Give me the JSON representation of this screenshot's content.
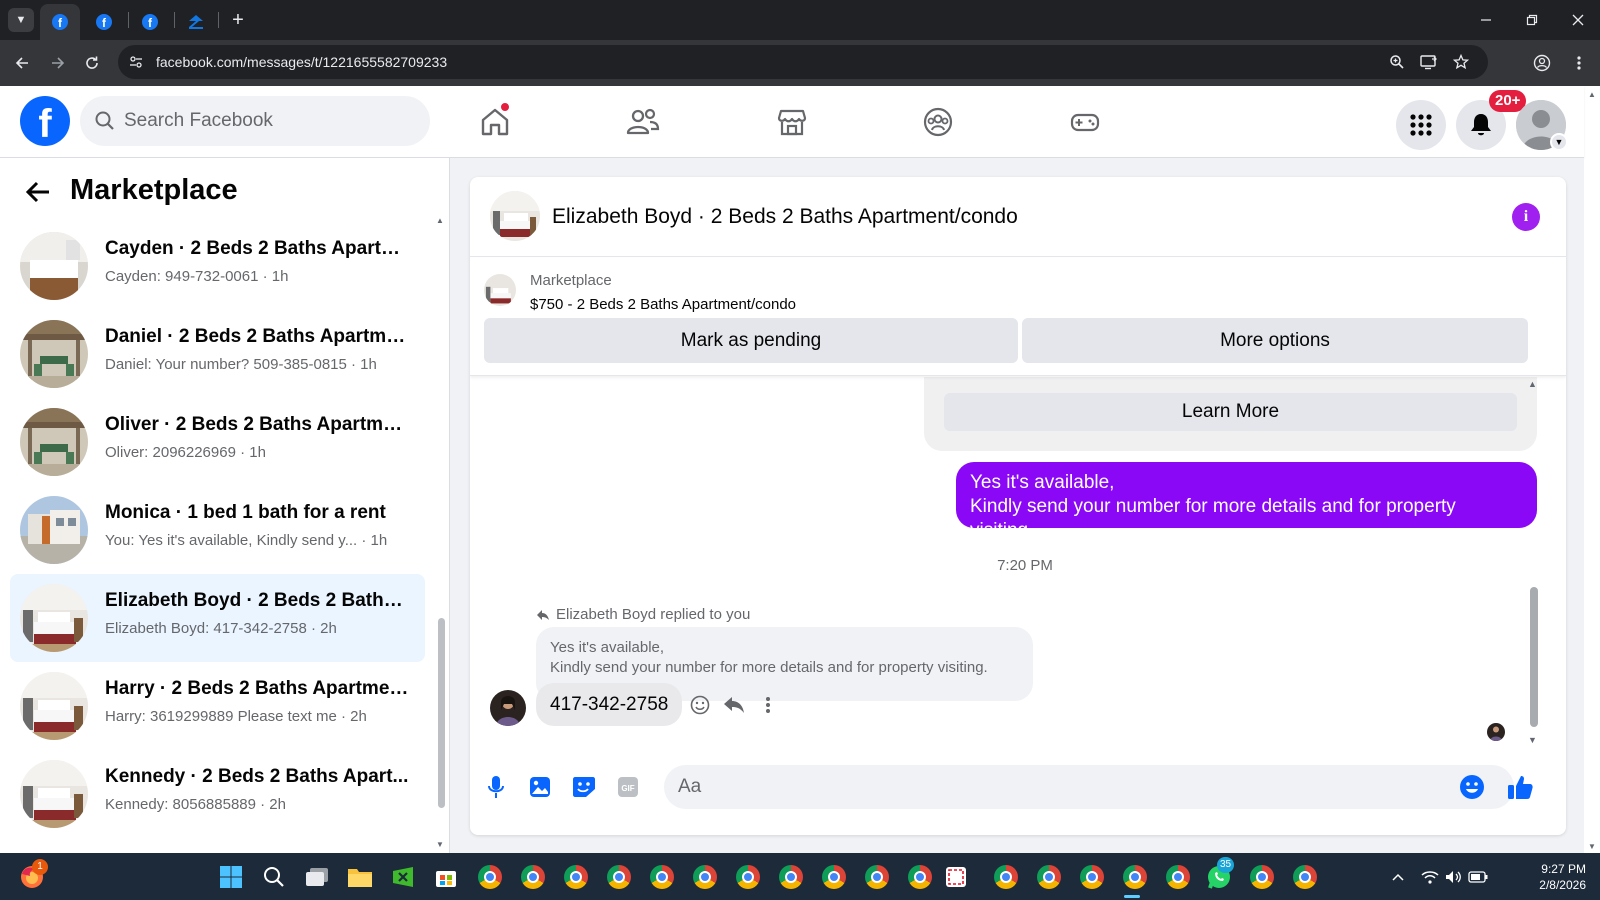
{
  "browser": {
    "url": "facebook.com/messages/t/1221655582709233",
    "tabs": [
      {
        "icon": "facebook-icon",
        "active": true
      },
      {
        "icon": "facebook-icon",
        "active": false
      },
      {
        "icon": "facebook-icon",
        "active": false
      },
      {
        "icon": "zillow-icon",
        "active": false
      }
    ]
  },
  "header": {
    "search_placeholder": "Search Facebook",
    "notification_count": "20+"
  },
  "left_panel": {
    "title": "Marketplace",
    "conversations": [
      {
        "title": "Cayden · 2 Beds 2 Baths Apartm...",
        "subtitle": "Cayden: 949-732-0061 · 1h",
        "thumb": "kitchen"
      },
      {
        "title": "Daniel · 2 Beds 2 Baths Apartme...",
        "subtitle": "Daniel: Your number? 509-385-0815 · 1h",
        "thumb": "patio"
      },
      {
        "title": "Oliver · 2 Beds 2 Baths Apartmen...",
        "subtitle": "Oliver: 2096226969 · 1h",
        "thumb": "patio"
      },
      {
        "title": "Monica · 1 bed 1 bath for a rent",
        "subtitle": "You: Yes it's available, Kindly send y... · 1h",
        "thumb": "building"
      },
      {
        "title": "Elizabeth Boyd · 2 Beds 2 Baths ...",
        "subtitle": "Elizabeth Boyd: 417-342-2758 · 2h",
        "thumb": "bedroom",
        "active": true
      },
      {
        "title": "Harry · 2 Beds 2 Baths Apartmen...",
        "subtitle": "Harry: 3619299889 Please text me · 2h",
        "thumb": "bedroom"
      },
      {
        "title": "Kennedy · 2 Beds 2 Baths Apart...",
        "subtitle": "Kennedy: 8056885889 · 2h",
        "thumb": "bedroom"
      }
    ]
  },
  "chat": {
    "title": "Elizabeth Boyd · 2 Beds 2 Baths Apartment/condo",
    "marketplace_label": "Marketplace",
    "listing": "$750 - 2 Beds 2 Baths Apartment/condo",
    "mark_pending_label": "Mark as pending",
    "more_options_label": "More options",
    "learn_more_label": "Learn More",
    "outgoing_line1": "Yes it's available,",
    "outgoing_line2": "Kindly send your number for more details and for property visiting.",
    "timestamp": "7:20 PM",
    "replied_label": "Elizabeth Boyd replied to you",
    "quoted_line1": "Yes it's available,",
    "quoted_line2": "Kindly send your number for more details and for property visiting.",
    "incoming": "417-342-2758",
    "composer_placeholder": "Aa"
  },
  "taskbar": {
    "time": "9:27 PM",
    "date": "2/8/2026",
    "whatsapp_badge": "35",
    "firefox_badge": "1"
  },
  "colors": {
    "fb_blue": "#0866ff",
    "accent_purple": "#8a08f5",
    "active_conv_bg": "#ebf5ff",
    "notification_red": "#e41e3f"
  }
}
